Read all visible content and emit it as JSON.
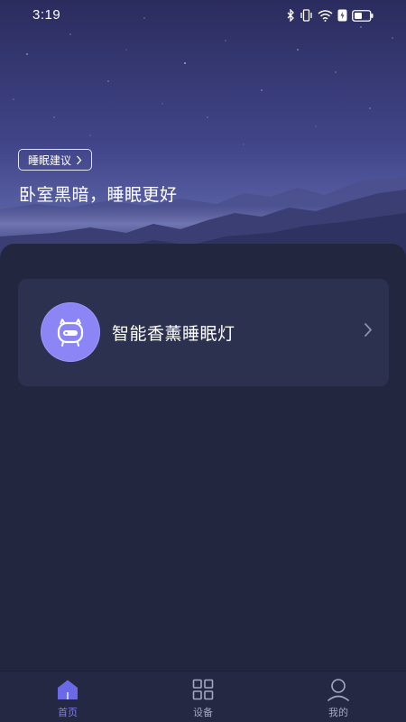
{
  "status_bar": {
    "time": "3:19",
    "icons": [
      "bluetooth-icon",
      "vibrate-icon",
      "wifi-icon",
      "battery-saver-icon",
      "battery-icon"
    ]
  },
  "hero": {
    "advice_chip_label": "睡眠建议",
    "headline": "卧室黑暗，睡眠更好"
  },
  "devices": [
    {
      "name": "智能香薰睡眠灯",
      "icon": "aroma-lamp-icon",
      "avatar_color": "#8b85f6"
    }
  ],
  "bottom_nav": {
    "tabs": [
      {
        "label": "首页",
        "icon": "home-icon",
        "active": true
      },
      {
        "label": "设备",
        "icon": "grid-icon",
        "active": false
      },
      {
        "label": "我的",
        "icon": "profile-icon",
        "active": false
      }
    ]
  },
  "colors": {
    "background": "#23263f",
    "card": "#2c3150",
    "accent": "#7f7cf0",
    "nav_inactive": "#a4a8bf"
  }
}
